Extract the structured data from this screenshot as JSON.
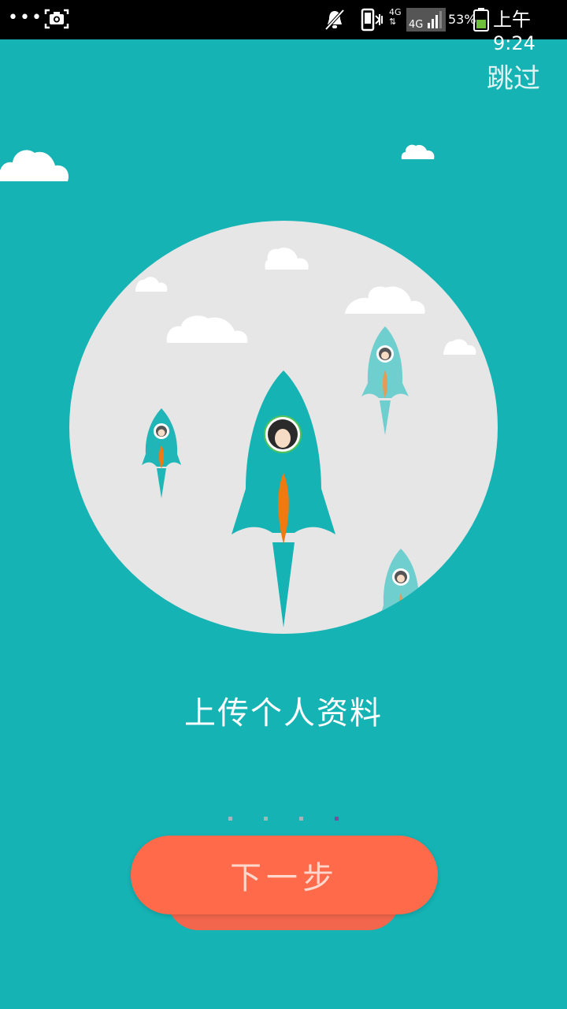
{
  "status_bar": {
    "dots": "•••",
    "network": "4G",
    "signal_badge": "4G",
    "battery_percent": "53%",
    "time": "上午9:24"
  },
  "header": {
    "skip_label": "跳过"
  },
  "main": {
    "title": "上传个人资料"
  },
  "pager": {
    "count": 4,
    "active_index": 3
  },
  "footer": {
    "next_label": "下一步"
  },
  "colors": {
    "background": "#15b3b4",
    "circle": "#e6e6e6",
    "rocket": "#15b3b4",
    "flame": "#f07a10",
    "button": "#ff6a4a",
    "active_dot": "#7a4d9c"
  }
}
